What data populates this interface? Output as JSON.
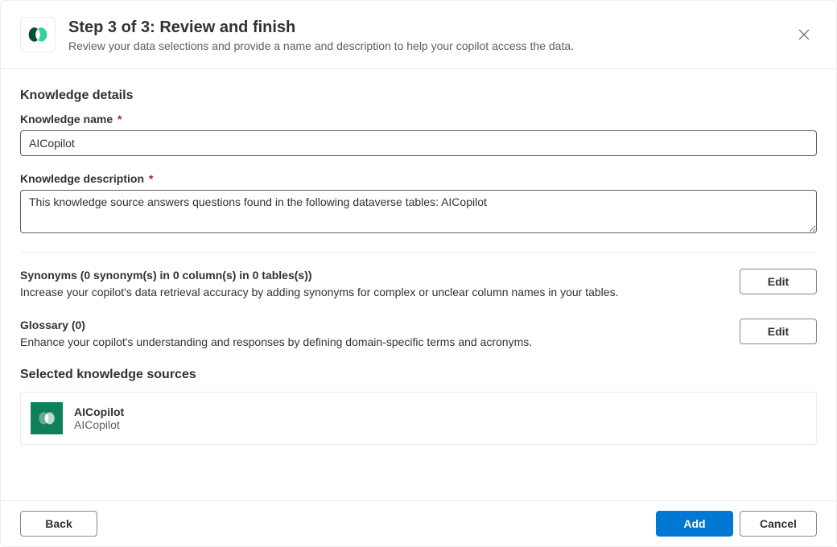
{
  "header": {
    "title": "Step 3 of 3: Review and finish",
    "subtitle": "Review your data selections and provide a name and description to help your copilot access the data."
  },
  "knowledge_details": {
    "section_title": "Knowledge details",
    "name_label": "Knowledge name",
    "name_value": "AICopilot",
    "description_label": "Knowledge description",
    "description_value": "This knowledge source answers questions found in the following dataverse tables: AICopilot"
  },
  "synonyms": {
    "label": "Synonyms (0 synonym(s) in 0 column(s) in 0 tables(s))",
    "description": "Increase your copilot's data retrieval accuracy by adding synonyms for complex or unclear column names in your tables.",
    "edit_label": "Edit"
  },
  "glossary": {
    "label": "Glossary (0)",
    "description": "Enhance your copilot's understanding and responses by defining domain-specific terms and acronyms.",
    "edit_label": "Edit"
  },
  "selected_sources": {
    "section_title": "Selected knowledge sources",
    "items": [
      {
        "title": "AICopilot",
        "subtitle": "AICopilot"
      }
    ]
  },
  "footer": {
    "back_label": "Back",
    "add_label": "Add",
    "cancel_label": "Cancel"
  }
}
